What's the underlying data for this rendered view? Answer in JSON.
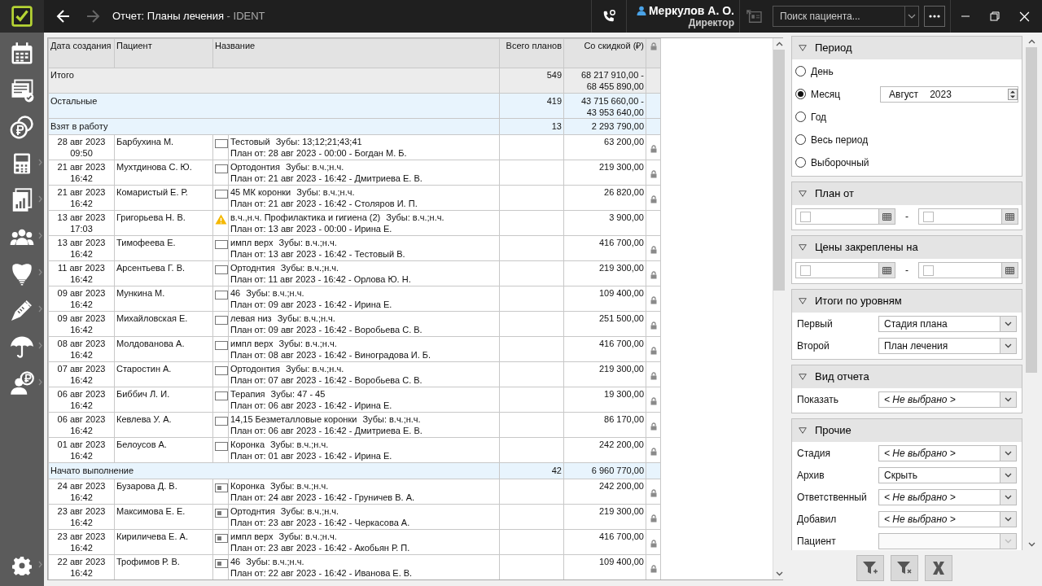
{
  "window": {
    "title": "Отчет: Планы лечения",
    "app": " - IDENT",
    "user": "Меркулов А. О.",
    "role": "Директор",
    "search": {
      "placeholder": "Поиск пациента..."
    },
    "back_disabled": false,
    "forward_disabled": true
  },
  "sidebar": {
    "items": [
      {
        "kind": "calendar",
        "submenu": false
      },
      {
        "kind": "list",
        "submenu": false
      },
      {
        "kind": "coins",
        "submenu": false
      },
      {
        "kind": "register",
        "submenu": true
      },
      {
        "kind": "chart",
        "submenu": true
      },
      {
        "kind": "people",
        "submenu": true
      },
      {
        "kind": "tooth",
        "submenu": true
      },
      {
        "kind": "syringe",
        "submenu": true
      },
      {
        "kind": "umbrella",
        "submenu": true
      },
      {
        "kind": "person",
        "submenu": true
      }
    ],
    "settings": {
      "submenu": true
    }
  },
  "table": {
    "columns": [
      "Дата создания",
      "Пациент",
      "Название",
      "Всего планов",
      "Со скидкой (₽)"
    ],
    "rows": [
      {
        "kind": "total",
        "label": "Итого",
        "count": "549",
        "amount": [
          "68 217 910,00 -",
          "68 455 890,00"
        ]
      },
      {
        "kind": "group",
        "label": "Остальные",
        "count": "419",
        "amount": [
          "43 715 660,00 -",
          "43 953 640,00"
        ]
      },
      {
        "kind": "group",
        "label": "Взят в работу",
        "count": "13",
        "amount": [
          "2 293 790,00"
        ]
      },
      {
        "kind": "plan",
        "date": "28 авг 2023",
        "time": "09:50",
        "patient": "Барбухина М.",
        "warning": false,
        "started": false,
        "title": "Тестовый",
        "teeth": "Зубы: 13;12;21;43;41",
        "plan": "План от: 28 авг 2023 - 00:00 - Богдан М. Б.",
        "amount": "63 200,00",
        "locked": true
      },
      {
        "kind": "plan",
        "date": "21 авг 2023",
        "time": "16:42",
        "patient": "Мухтдинова С. Ю.",
        "warning": false,
        "started": false,
        "title": "Ортодонтия",
        "teeth": "Зубы: в.ч.;н.ч.",
        "plan": "План от: 21 авг 2023 - 16:42 - Дмитриева Е. В.",
        "amount": "219 300,00",
        "locked": true
      },
      {
        "kind": "plan",
        "date": "21 авг 2023",
        "time": "16:42",
        "patient": "Комаристый Е. Р.",
        "warning": false,
        "started": false,
        "title": "45 МК коронки",
        "teeth": "Зубы: в.ч.;н.ч.",
        "plan": "План от: 21 авг 2023 - 16:42 - Столяров И. П.",
        "amount": "26 820,00",
        "locked": true
      },
      {
        "kind": "plan",
        "date": "13 авг 2023",
        "time": "17:03",
        "patient": "Григорьева Н. В.",
        "warning": true,
        "title": "в.ч.,н.ч. Профилактика и гигиена (2)",
        "teeth": "Зубы: в.ч.;н.ч.",
        "plan": "План от: 13 авг 2023 - 00:00 - Ирина Е.",
        "amount": "3 900,00",
        "locked": false
      },
      {
        "kind": "plan",
        "date": "13 авг 2023",
        "time": "16:42",
        "patient": "Тимофеева Е.",
        "warning": false,
        "started": false,
        "title": "импл верх",
        "teeth": "Зубы: в.ч.;н.ч.",
        "plan": "План от: 13 авг 2023 - 16:42 - Тестовый В.",
        "amount": "416 700,00",
        "locked": true
      },
      {
        "kind": "plan",
        "date": "11 авг 2023",
        "time": "16:42",
        "patient": "Арсентьева Г. В.",
        "warning": false,
        "started": false,
        "title": "Ортоднтия",
        "teeth": "Зубы: в.ч.;н.ч.",
        "plan": "План от: 11 авг 2023 - 16:42 - Орлова Ю. Н.",
        "amount": "219 300,00",
        "locked": true
      },
      {
        "kind": "plan",
        "date": "09 авг 2023",
        "time": "16:42",
        "patient": "Мункина М.",
        "warning": false,
        "started": false,
        "title": "46",
        "teeth": "Зубы: в.ч.;н.ч.",
        "plan": "План от: 09 авг 2023 - 16:42 - Ирина Е.",
        "amount": "109 400,00",
        "locked": true
      },
      {
        "kind": "plan",
        "date": "09 авг 2023",
        "time": "16:42",
        "patient": "Михайловская Е.",
        "warning": false,
        "started": false,
        "title": "левая низ",
        "teeth": "Зубы: в.ч.;н.ч.",
        "plan": "План от: 09 авг 2023 - 16:42 - Воробьева С. В.",
        "amount": "251 500,00",
        "locked": true
      },
      {
        "kind": "plan",
        "date": "08 авг 2023",
        "time": "16:42",
        "patient": "Молдованова А.",
        "warning": false,
        "started": false,
        "title": "импл верх",
        "teeth": "Зубы: в.ч.;н.ч.",
        "plan": "План от: 08 авг 2023 - 16:42 - Виноградова И. Б.",
        "amount": "416 700,00",
        "locked": true
      },
      {
        "kind": "plan",
        "date": "07 авг 2023",
        "time": "16:42",
        "patient": "Старостин А.",
        "warning": false,
        "started": false,
        "title": "Ортодонтия",
        "teeth": "Зубы: в.ч.;н.ч.",
        "plan": "План от: 07 авг 2023 - 16:42 - Воробьева С. В.",
        "amount": "219 300,00",
        "locked": true
      },
      {
        "kind": "plan",
        "date": "06 авг 2023",
        "time": "16:42",
        "patient": "Биббич Л. И.",
        "warning": false,
        "started": false,
        "title": "Терапия",
        "teeth": "Зубы: 47 - 45",
        "plan": "План от: 06 авг 2023 - 16:42 - Ирина Е.",
        "amount": "19 300,00",
        "locked": true
      },
      {
        "kind": "plan",
        "date": "06 авг 2023",
        "time": "16:42",
        "patient": "Кевлева У. А.",
        "warning": false,
        "started": false,
        "title": "14,15 Безметалловые коронки",
        "teeth": "Зубы: в.ч.;н.ч.",
        "plan": "План от: 06 авг 2023 - 16:42 - Дмитриева Е. В.",
        "amount": "86 170,00",
        "locked": true
      },
      {
        "kind": "plan",
        "date": "01 авг 2023",
        "time": "16:42",
        "patient": "Белоусов А.",
        "warning": false,
        "started": false,
        "title": "Коронка",
        "teeth": "Зубы: в.ч.;н.ч.",
        "plan": "План от: 01 авг 2023 - 16:42 - Ирина Е.",
        "amount": "242 200,00",
        "locked": true
      },
      {
        "kind": "group",
        "label": "Начато выполнение",
        "count": "42",
        "amount": [
          "6 960 770,00"
        ]
      },
      {
        "kind": "plan",
        "date": "24 авг 2023",
        "time": "16:42",
        "patient": "Бузарова Д. В.",
        "warning": false,
        "started": true,
        "title": "Коронка",
        "teeth": "Зубы: в.ч.;н.ч.",
        "plan": "План от: 24 авг 2023 - 16:42 - Груничев В. А.",
        "amount": "242 200,00",
        "locked": true
      },
      {
        "kind": "plan",
        "date": "23 авг 2023",
        "time": "16:42",
        "patient": "Максимова Е. Е.",
        "warning": false,
        "started": true,
        "title": "Ортоднтия",
        "teeth": "Зубы: в.ч.;н.ч.",
        "plan": "План от: 23 авг 2023 - 16:42 - Черкасова А.",
        "amount": "219 300,00",
        "locked": true
      },
      {
        "kind": "plan",
        "date": "23 авг 2023",
        "time": "16:42",
        "patient": "Кириличева Е. А.",
        "warning": false,
        "started": true,
        "title": "импл верх",
        "teeth": "Зубы: в.ч.;н.ч.",
        "plan": "План от: 23 авг 2023 - 16:42 - Акобьян Р. П.",
        "amount": "416 700,00",
        "locked": true
      },
      {
        "kind": "plan",
        "date": "22 авг 2023",
        "time": "16:42",
        "patient": "Трофимов Р. В.",
        "warning": false,
        "started": true,
        "title": "46",
        "teeth": "Зубы: в.ч.;н.ч.",
        "plan": "План от: 22 авг 2023 - 16:42 - Иванова Е. В.",
        "amount": "109 400,00",
        "locked": true
      }
    ]
  },
  "filters": [
    {
      "kind": "period",
      "title": "Период",
      "expanded": true,
      "options": [
        {
          "label": "День",
          "selected": false
        },
        {
          "label": "Месяц",
          "selected": true
        },
        {
          "label": "Год",
          "selected": false
        },
        {
          "label": "Весь период",
          "selected": false
        },
        {
          "label": "Выборочный",
          "selected": false
        }
      ],
      "month": "Август",
      "year": "2023"
    },
    {
      "kind": "range",
      "title": "План от",
      "expanded": true,
      "from_checked": false,
      "to_checked": false,
      "separator": "-"
    },
    {
      "kind": "range",
      "title": "Цены закреплены на",
      "expanded": true,
      "from_checked": false,
      "to_checked": false,
      "separator": "-"
    },
    {
      "kind": "selects",
      "title": "Итоги по уровням",
      "expanded": true,
      "fields": [
        {
          "label": "Первый",
          "value": "Стадия плана",
          "empty": false,
          "disabled": false
        },
        {
          "label": "Второй",
          "value": "План лечения",
          "empty": false,
          "disabled": false
        }
      ]
    },
    {
      "kind": "selects",
      "title": "Вид отчета",
      "expanded": true,
      "fields": [
        {
          "label": "Показать",
          "value": "< Не выбрано >",
          "empty": true,
          "disabled": false
        }
      ]
    },
    {
      "kind": "selects",
      "title": "Прочие",
      "expanded": true,
      "fields": [
        {
          "label": "Стадия",
          "value": "< Не выбрано >",
          "empty": true,
          "disabled": false
        },
        {
          "label": "Архив",
          "value": "Скрыть",
          "empty": false,
          "disabled": false
        },
        {
          "label": "Ответственный",
          "value": "< Не выбрано >",
          "empty": true,
          "disabled": false
        },
        {
          "label": "Добавил",
          "value": "< Не выбрано >",
          "empty": true,
          "disabled": false
        },
        {
          "label": "Пациент",
          "disabled": true
        }
      ]
    }
  ]
}
